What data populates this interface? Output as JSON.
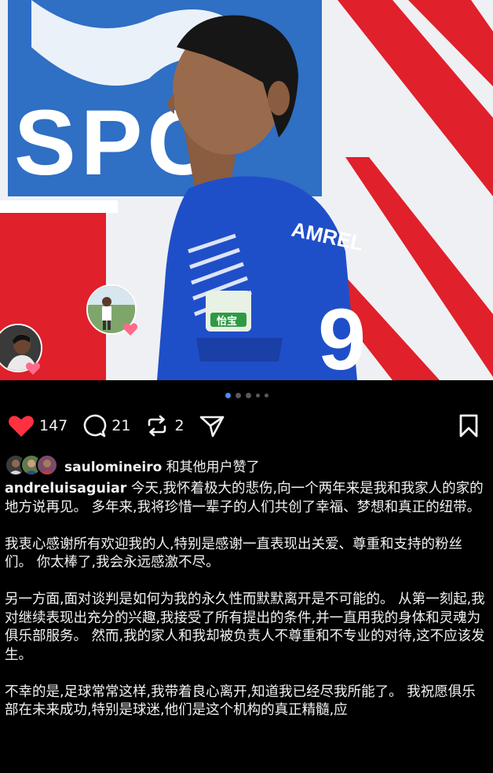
{
  "post": {
    "author": "andreluisaguiar",
    "jersey_name": "AMREL",
    "jersey_number": "9",
    "sponsor_label": "怡宝",
    "club_letters": "SPC"
  },
  "actions": {
    "likes_count": "147",
    "comments_count": "21",
    "reposts_count": "2"
  },
  "pager": {
    "count": 5,
    "active_index": 0
  },
  "liked_by": {
    "user": "saulomineiro",
    "suffix": " 和其他用户赞了"
  },
  "caption": {
    "first_text": " 今天,我怀着极大的悲伤,向一个两年来是我和我家人的家的地方说再见。 多年来,我将珍惜一辈子的人们共创了幸福、梦想和真正的纽带。",
    "para2": "我衷心感谢所有欢迎我的人,特别是感谢一直表现出关爱、尊重和支持的粉丝们。 你太棒了,我会永远感激不尽。",
    "para3": "另一方面,面对谈判是如何为我的永久性而默默离开是不可能的。 从第一刻起,我对继续表现出充分的兴趣,我接受了所有提出的条件,并一直用我的身体和灵魂为俱乐部服务。 然而,我的家人和我却被负责人不尊重和不专业的对待,这不应该发生。",
    "para4": "不幸的是,足球常常这样,我带着良心离开,知道我已经尽我所能了。 我祝愿俱乐部在未来成功,特别是球迷,他们是这个机构的真正精髓,应"
  },
  "colors": {
    "background": "#000000",
    "text": "#f2f2f2",
    "like_red": "#ff3040",
    "dot_active": "#4c8dff",
    "jersey_blue": "#1f4fc8",
    "wall_red": "#e0202a"
  },
  "icons": {
    "like": "heart-filled-icon",
    "comment": "comment-bubble-icon",
    "repost": "repost-icon",
    "share": "send-icon",
    "save": "bookmark-icon"
  }
}
